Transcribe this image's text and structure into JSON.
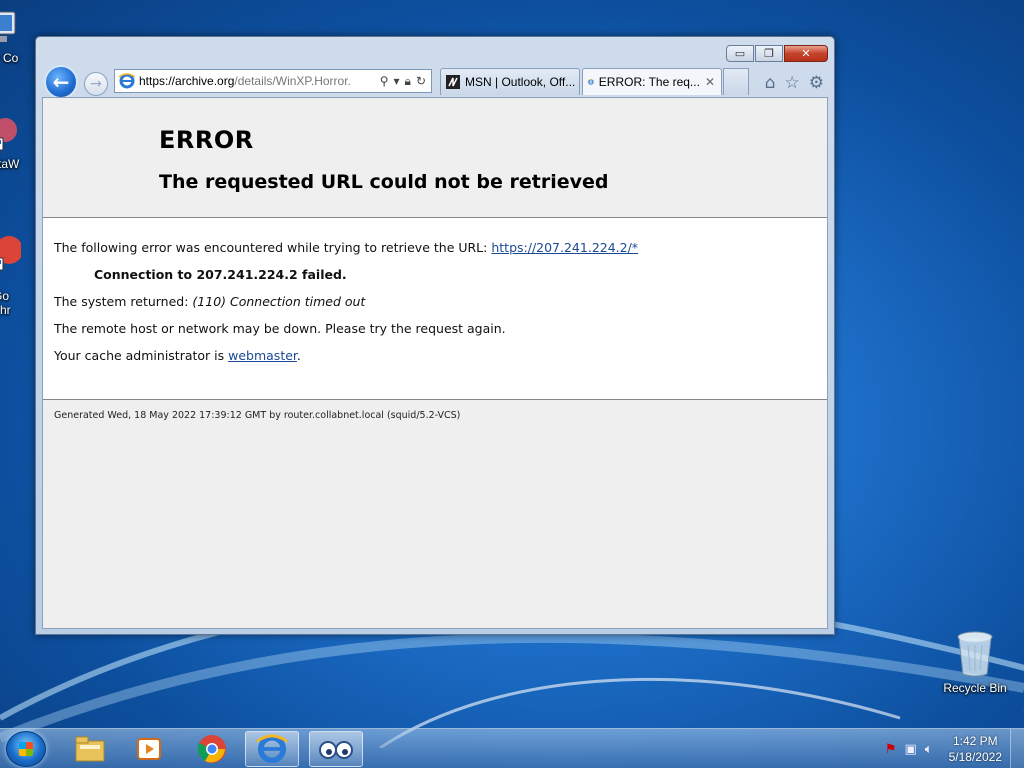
{
  "desktop": {
    "icons": [
      {
        "label": "My Co",
        "icon": "computer-icon"
      },
      {
        "label": "DataW",
        "icon": "datawrapper-shortcut-icon"
      },
      {
        "label": "Go\nChr",
        "icon": "chrome-shortcut-icon"
      },
      {
        "label": "Recycle Bin",
        "icon": "recycle-bin-icon"
      }
    ]
  },
  "window": {
    "caption": {
      "min": "▭",
      "max": "❐",
      "close": "✕"
    },
    "address": {
      "host": "https://archive.org",
      "path": "/details/WinXP.Horror."
    },
    "tabs": [
      {
        "label": "MSN | Outlook, Off...",
        "icon": "msn-icon"
      },
      {
        "label": "ERROR: The req...",
        "icon": "ie-icon",
        "close": "✕"
      }
    ],
    "tools": {
      "home": "⌂",
      "favorites": "☆",
      "settings": "⚙"
    }
  },
  "page": {
    "title": "ERROR",
    "subtitle": "The requested URL could not be retrieved",
    "line1_text": "The following error was encountered while trying to retrieve the URL: ",
    "line1_link": "https://207.241.224.2/*",
    "line2": "Connection to 207.241.224.2 failed.",
    "line3_prefix": "The system returned: ",
    "line3_em": "(110) Connection timed out",
    "line4": "The remote host or network may be down. Please try the request again.",
    "line5_prefix": "Your cache administrator is ",
    "line5_link": "webmaster",
    "line5_suffix": ".",
    "footer": "Generated Wed, 18 May 2022 17:39:12 GMT by router.collabnet.local (squid/5.2-VCS)"
  },
  "taskbar": {
    "time": "1:42 PM",
    "date": "5/18/2022"
  },
  "colors": {
    "link": "#1a4a95",
    "desktop": "#1d6fc9"
  }
}
